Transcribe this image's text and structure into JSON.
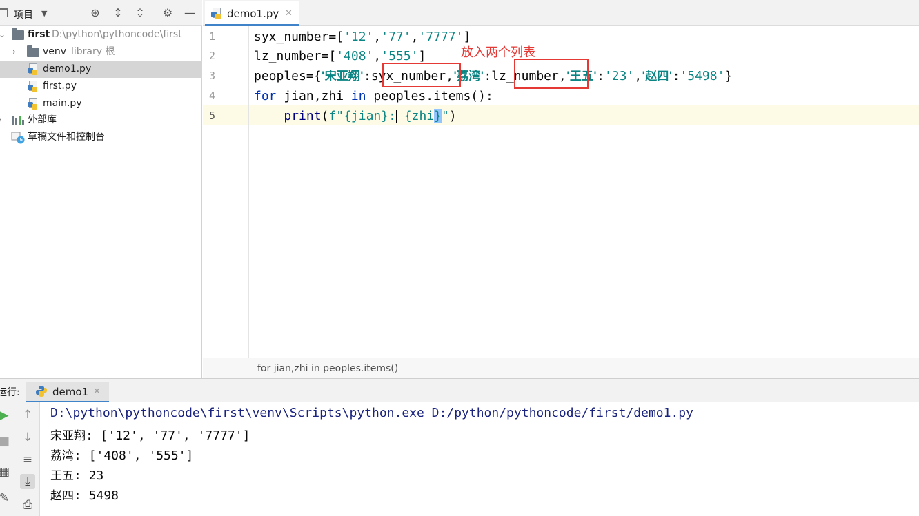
{
  "project": {
    "title": "项目",
    "tree": [
      {
        "name": "first",
        "path": "D:\\python\\pythoncode\\first"
      },
      {
        "name": "venv",
        "note": "library 根"
      },
      {
        "name": "demo1.py"
      },
      {
        "name": "first.py"
      },
      {
        "name": "main.py"
      },
      {
        "name": "外部库"
      },
      {
        "name": "草稿文件和控制台"
      }
    ]
  },
  "editor": {
    "tab": "demo1.py",
    "line_numbers": [
      "1",
      "2",
      "3",
      "4",
      "5"
    ],
    "lines": {
      "l1": {
        "a": "syx_number=[",
        "s1": "'12'",
        "c1": ",",
        "s2": "'77'",
        "c2": ",",
        "s3": "'7777'",
        "e": "]"
      },
      "l2": {
        "a": "lz_number=[",
        "s1": "'408'",
        "c1": ",",
        "s2": "'555'",
        "e": "]"
      },
      "l3": {
        "a": "peoples={",
        "k1": "'宋亚翔'",
        "p1": ":",
        "v1": "syx_number",
        "p2": ",",
        "k2": "'荔湾'",
        "p3": ":",
        "v2": "lz_number",
        "p4": ",",
        "k3": "'王五'",
        "p5": ":",
        "v3": "'23'",
        "p6": ",",
        "k4": "'赵四'",
        "p7": ":",
        "v4": "'5498'",
        "e": "}"
      },
      "l4": {
        "kw1": "for",
        "b": " jian,zhi ",
        "kw2": "in",
        "c": " peoples.items():"
      },
      "l5": {
        "indent": "    ",
        "fn": "print",
        "a": "(",
        "s1": "f\"{jian}:",
        "s2": "{zhi",
        "s3": "}",
        "s4": "\"",
        "e": ")"
      }
    },
    "annotation": "放入两个列表",
    "breadcrumb": "for jian,zhi in peoples.items()"
  },
  "run": {
    "title": "运行:",
    "tab": "demo1",
    "output": [
      "D:\\python\\pythoncode\\first\\venv\\Scripts\\python.exe D:/python/pythoncode/first/demo1.py",
      {
        "cn": "宋亚翔",
        "rest": ": ['12', '77', '7777']"
      },
      {
        "cn": "荔湾",
        "rest": ": ['408', '555']"
      },
      {
        "cn": "王五",
        "rest": ": 23"
      },
      {
        "cn": "赵四",
        "rest": ": 5498"
      }
    ]
  },
  "colors": {
    "accent": "#4083c9",
    "annotation_red": "#e53935",
    "string": "#0a8583",
    "keyword": "#0033b3"
  }
}
